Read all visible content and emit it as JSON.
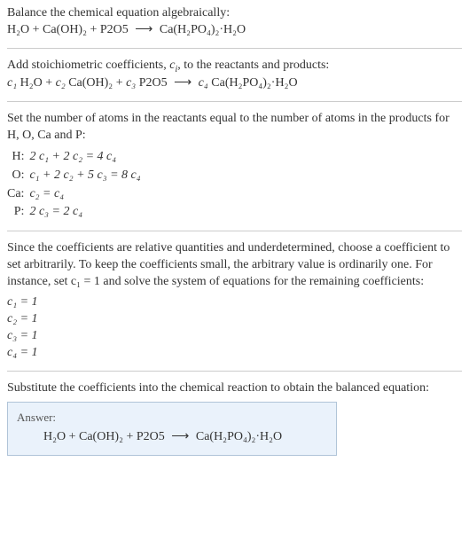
{
  "intro": {
    "title": "Balance the chemical equation algebraically:",
    "reaction_lhs": "H₂O + Ca(OH)₂ + P2O5",
    "reaction_rhs": "Ca(H₂PO₄)₂·H₂O"
  },
  "step1": {
    "title_prefix": "Add stoichiometric coefficients, ",
    "ci": "c",
    "ci_sub": "i",
    "title_suffix": ", to the reactants and products:",
    "c1": "c₁",
    "t1": "H₂O",
    "c2": "c₂",
    "t2": "Ca(OH)₂",
    "c3": "c₃",
    "t3": "P2O5",
    "c4": "c₄",
    "t4": "Ca(H₂PO₄)₂·H₂O"
  },
  "step2": {
    "title": "Set the number of atoms in the reactants equal to the number of atoms in the products for H, O, Ca and P:",
    "rows": {
      "H": {
        "label": "H:",
        "eq": "2 c₁ + 2 c₂ = 4 c₄"
      },
      "O": {
        "label": "O:",
        "eq": "c₁ + 2 c₂ + 5 c₃ = 8 c₄"
      },
      "Ca": {
        "label": "Ca:",
        "eq": "c₂ = c₄"
      },
      "P": {
        "label": "P:",
        "eq": "2 c₃ = 2 c₄"
      }
    }
  },
  "step3": {
    "title": "Since the coefficients are relative quantities and underdetermined, choose a coefficient to set arbitrarily. To keep the coefficients small, the arbitrary value is ordinarily one. For instance, set c₁ = 1 and solve the system of equations for the remaining coefficients:",
    "solved": {
      "c1": "c₁ = 1",
      "c2": "c₂ = 1",
      "c3": "c₃ = 1",
      "c4": "c₄ = 1"
    }
  },
  "step4": {
    "title": "Substitute the coefficients into the chemical reaction to obtain the balanced equation:"
  },
  "answer": {
    "label": "Answer:",
    "eq_lhs": "H₂O + Ca(OH)₂ + P2O5",
    "eq_rhs": "Ca(H₂PO₄)₂·H₂O"
  },
  "arrow": "⟶"
}
